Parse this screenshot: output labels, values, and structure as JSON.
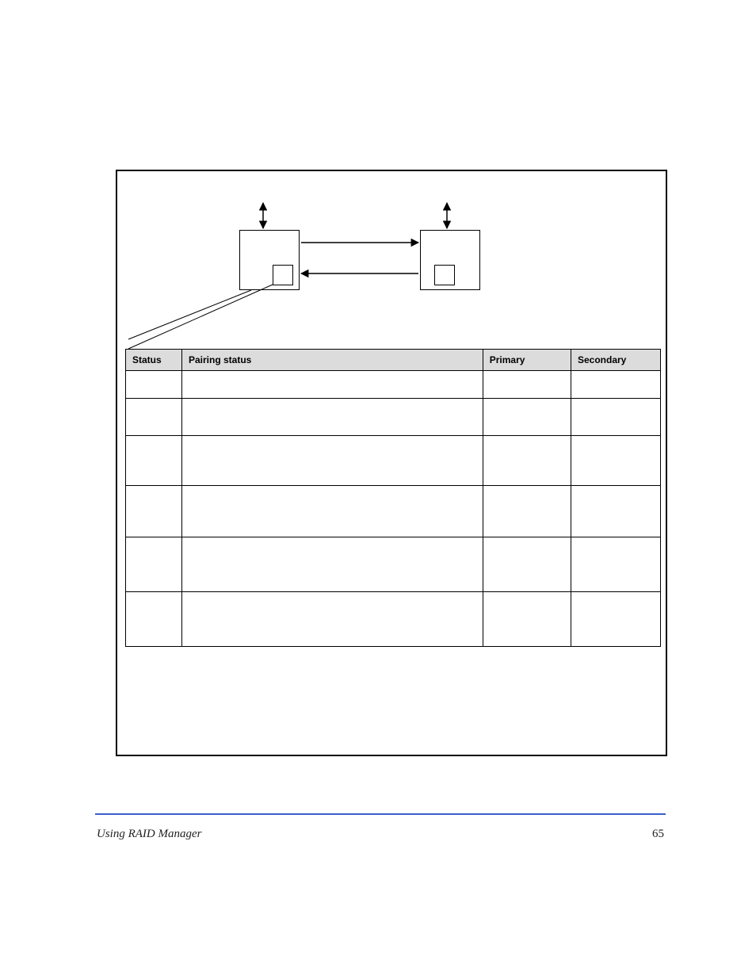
{
  "table": {
    "headers": {
      "status": "Status",
      "pairing": "Pairing status",
      "primary": "Primary",
      "secondary": "Secondary"
    },
    "rows": [
      {
        "status": "",
        "pairing": "",
        "primary": "",
        "secondary": ""
      },
      {
        "status": "",
        "pairing": "",
        "primary": "",
        "secondary": ""
      },
      {
        "status": "",
        "pairing": "",
        "primary": "",
        "secondary": ""
      },
      {
        "status": "",
        "pairing": "",
        "primary": "",
        "secondary": ""
      },
      {
        "status": "",
        "pairing": "",
        "primary": "",
        "secondary": ""
      },
      {
        "status": "",
        "pairing": "",
        "primary": "",
        "secondary": ""
      }
    ]
  },
  "footer": {
    "left": "Using RAID Manager",
    "right": "65"
  }
}
